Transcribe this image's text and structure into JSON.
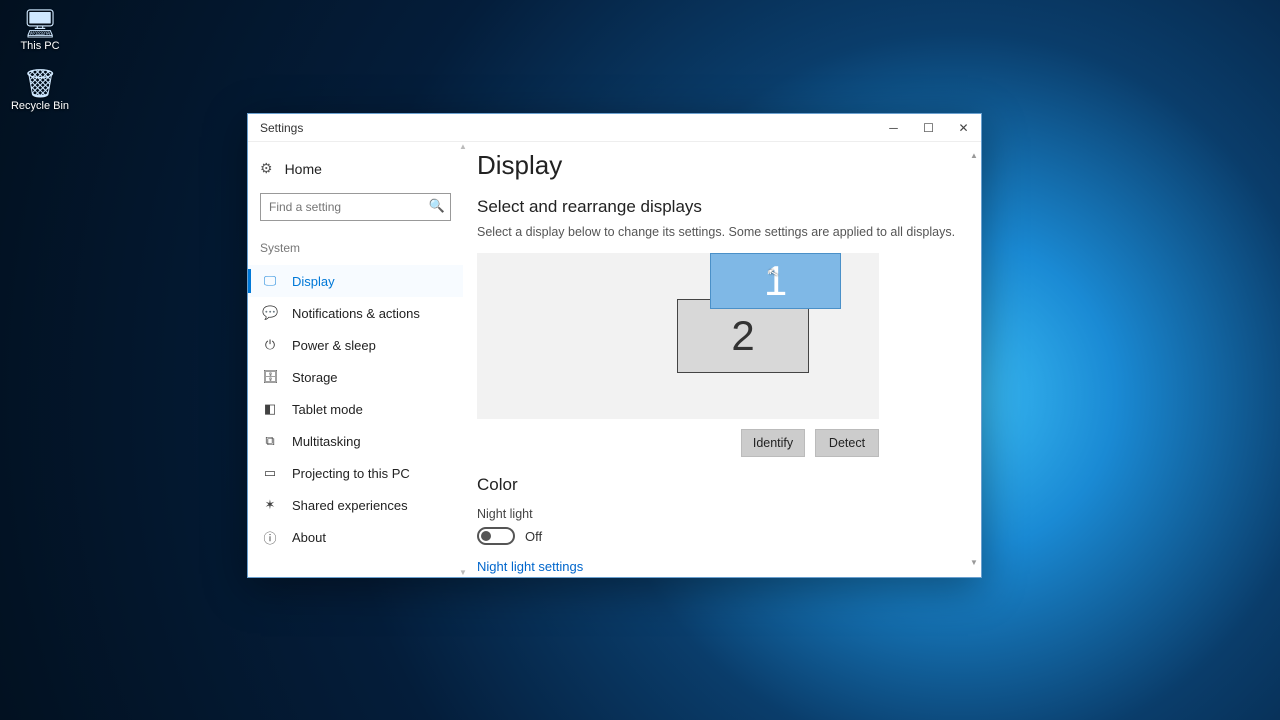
{
  "desktop": {
    "this_pc": "This PC",
    "recycle_bin": "Recycle Bin"
  },
  "window": {
    "title": "Settings"
  },
  "sidebar": {
    "home": "Home",
    "search_placeholder": "Find a setting",
    "section": "System",
    "items": [
      {
        "label": "Display",
        "icon": "🖵"
      },
      {
        "label": "Notifications & actions",
        "icon": "💬"
      },
      {
        "label": "Power & sleep",
        "icon": "⏻"
      },
      {
        "label": "Storage",
        "icon": "🗄"
      },
      {
        "label": "Tablet mode",
        "icon": "◧"
      },
      {
        "label": "Multitasking",
        "icon": "⧉"
      },
      {
        "label": "Projecting to this PC",
        "icon": "▭"
      },
      {
        "label": "Shared experiences",
        "icon": "✶"
      },
      {
        "label": "About",
        "icon": "ⓘ"
      }
    ]
  },
  "main": {
    "heading": "Display",
    "rearrange_heading": "Select and rearrange displays",
    "rearrange_desc": "Select a display below to change its settings. Some settings are applied to all displays.",
    "monitor1": "1",
    "monitor2": "2",
    "identify": "Identify",
    "detect": "Detect",
    "color_heading": "Color",
    "night_light_label": "Night light",
    "night_light_state": "Off",
    "night_light_link": "Night light settings"
  }
}
